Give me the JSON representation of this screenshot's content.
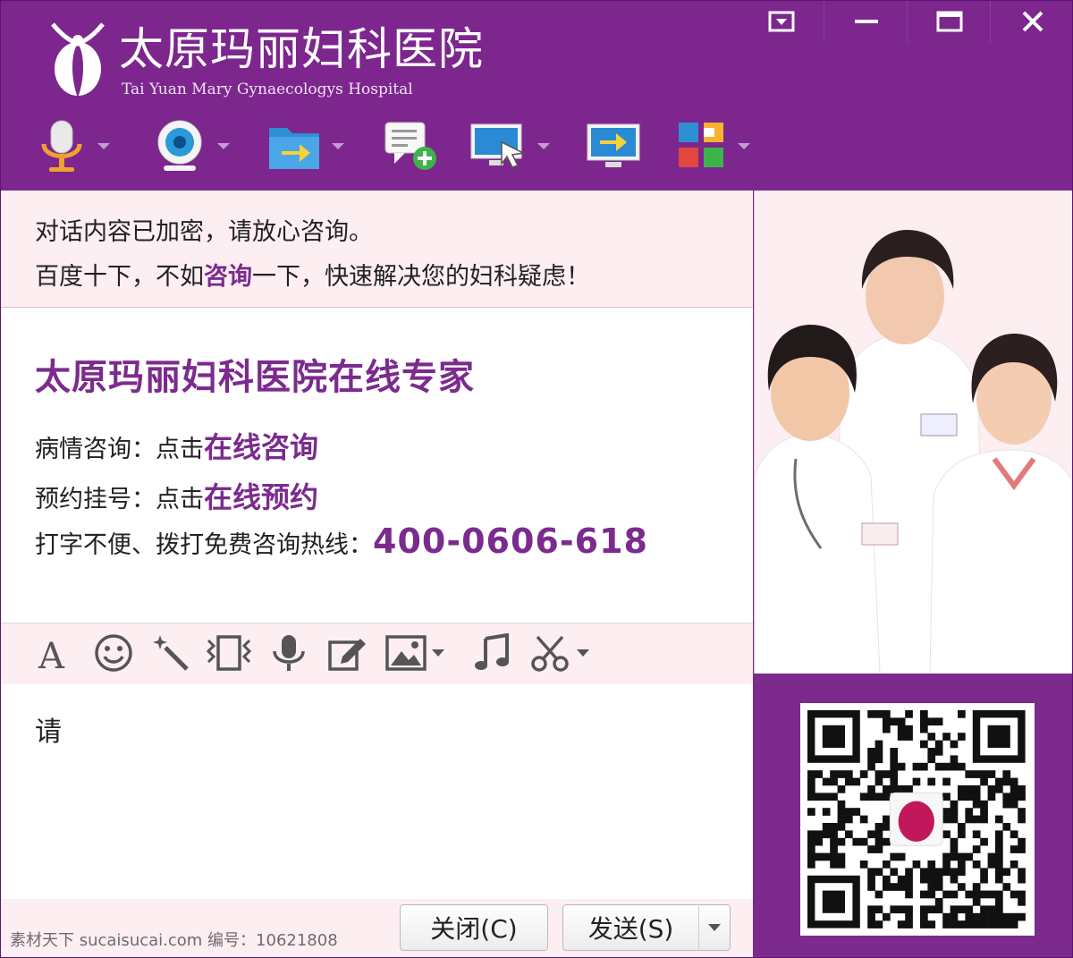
{
  "window": {
    "logo_cn": "太原玛丽妇科医院",
    "logo_en": "Tai Yuan Mary Gynaecologys Hospital",
    "controls": [
      "menu-icon",
      "minimize-icon",
      "maximize-icon",
      "close-icon"
    ]
  },
  "toolbar": {
    "items": [
      "microphone-icon",
      "webcam-icon",
      "send-file-icon",
      "new-message-icon",
      "remote-assist-icon",
      "screen-share-icon",
      "apps-grid-icon"
    ]
  },
  "notice": {
    "line1": "对话内容已加密，请放心咨询。",
    "line2_pre": "百度十下，不如",
    "line2_hl": "咨询",
    "line2_post": "一下，快速解决您的妇科疑虑！"
  },
  "message": {
    "title": "太原玛丽妇科医院在线专家",
    "row1_label": "病情咨询：点击",
    "row1_link": "在线咨询",
    "row2_label": "预约挂号：点击",
    "row2_link": "在线预约",
    "row3_label": "打字不便、拨打免费咨询热线：",
    "row3_phone": "400-0606-618"
  },
  "format_toolbar": {
    "items": [
      "font-icon",
      "emoji-icon",
      "magic-wand-icon",
      "shake-icon",
      "voice-icon",
      "edit-note-icon",
      "image-icon",
      "music-icon",
      "screenshot-scissors-icon"
    ]
  },
  "input": {
    "text": "请"
  },
  "buttons": {
    "close_label": "关闭(C)",
    "send_label": "发送(S)"
  },
  "watermark": "素材天下 sucaisucai.com  编号：10621808",
  "colors": {
    "brand_purple": "#7c268e",
    "panel_pink": "#fdeef2",
    "link_purple": "#7b2b8e"
  }
}
